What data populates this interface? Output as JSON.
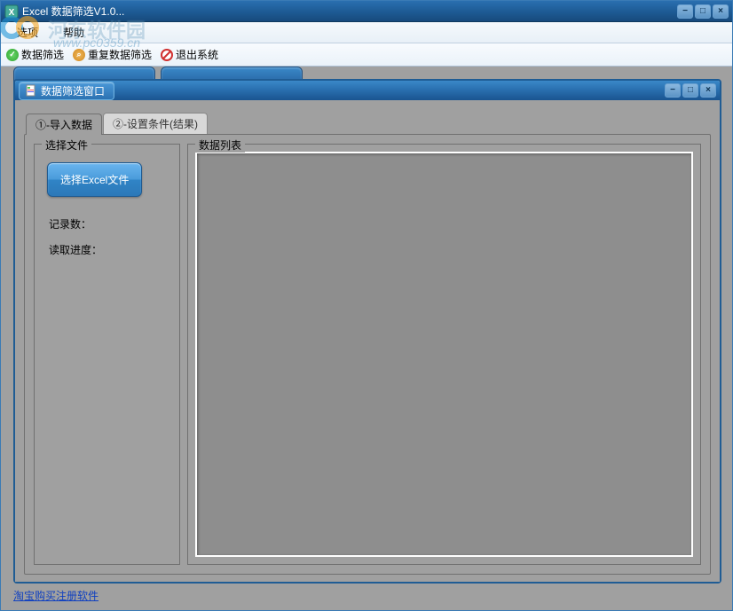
{
  "outer_window": {
    "title": "Excel 数据筛选V1.0..."
  },
  "watermark": {
    "text": "河东软件园",
    "sub": "www.pc0359.cn"
  },
  "menubar": {
    "options": "选项",
    "help": "帮助"
  },
  "toolbar": {
    "filter": "数据筛选",
    "dup_filter": "重复数据筛选",
    "exit": "退出系统"
  },
  "child_window": {
    "title": "数据筛选窗口"
  },
  "tabs": {
    "tab1": "①-导入数据",
    "tab2": "②-设置条件(结果)"
  },
  "left_group": {
    "title": "选择文件",
    "select_btn": "选择Excel文件",
    "records": "记录数：",
    "progress": "读取进度："
  },
  "right_group": {
    "title": "数据列表"
  },
  "footer": {
    "link": "淘宝购买注册软件"
  },
  "window_buttons": {
    "min": "−",
    "max": "□",
    "close": "×"
  }
}
